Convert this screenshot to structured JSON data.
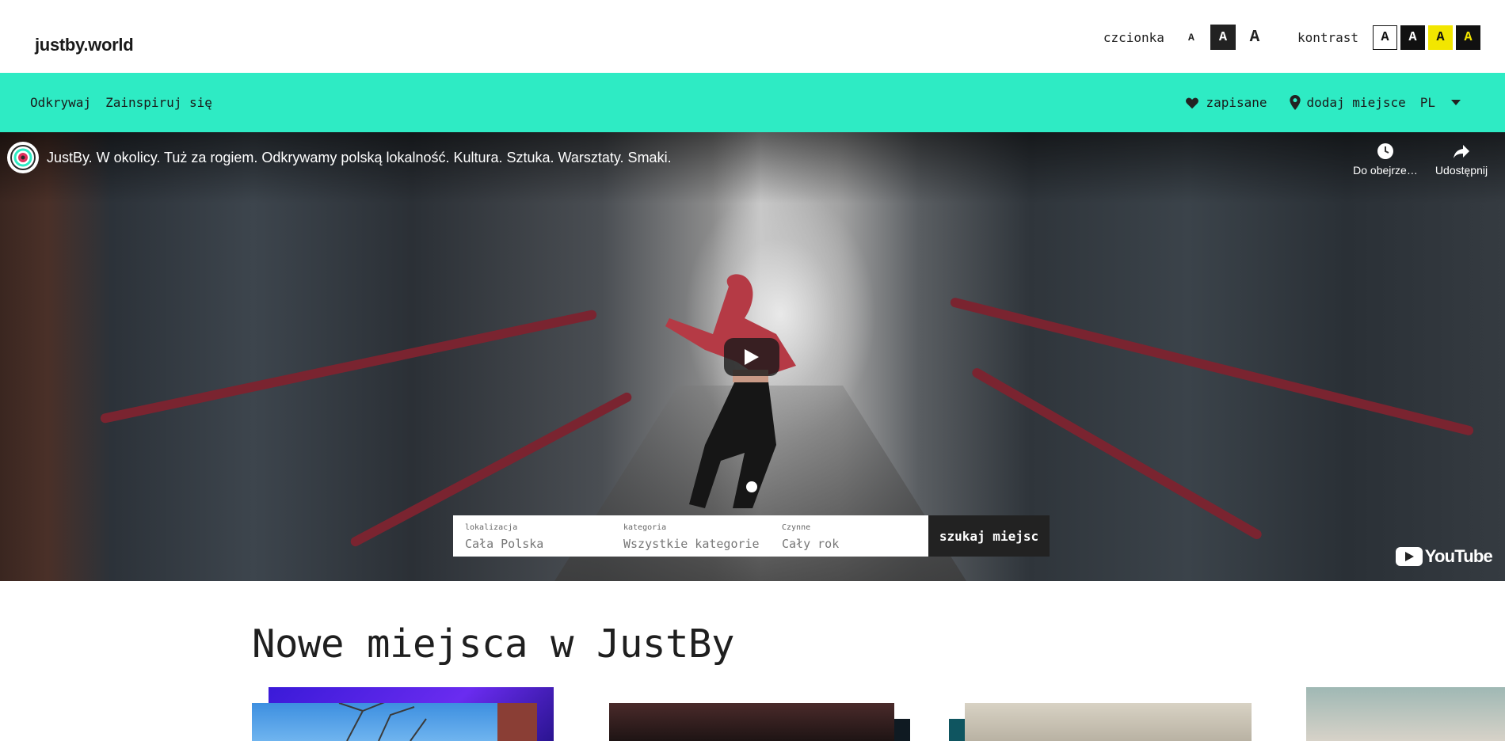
{
  "header": {
    "logo": "justby.world",
    "font_label": "czcionka",
    "font_sizes": [
      "A",
      "A",
      "A"
    ],
    "contrast_label": "kontrast",
    "contrast_options": [
      "A",
      "A",
      "A",
      "A"
    ]
  },
  "nav": {
    "links": [
      "Odkrywaj",
      "Zainspiruj się"
    ],
    "saved_label": "zapisane",
    "add_place_label": "dodaj miejsce",
    "language": "PL",
    "accent_color": "#2eebc4"
  },
  "video": {
    "title": "JustBy. W okolicy. Tuż za rogiem. Odkrywamy polską lokalność. Kultura. Sztuka. Warsztaty. Smaki.",
    "watch_later_label": "Do obejrze…",
    "share_label": "Udostępnij",
    "brand": "YouTube"
  },
  "search": {
    "location_caption": "lokalizacja",
    "location_value": "Cała Polska",
    "category_caption": "kategoria",
    "category_value": "Wszystkie kategorie",
    "active_caption": "Czynne",
    "active_value": "Cały rok",
    "button_label": "szukaj miejsc"
  },
  "section": {
    "title": "Nowe miejsca w JustBy"
  }
}
